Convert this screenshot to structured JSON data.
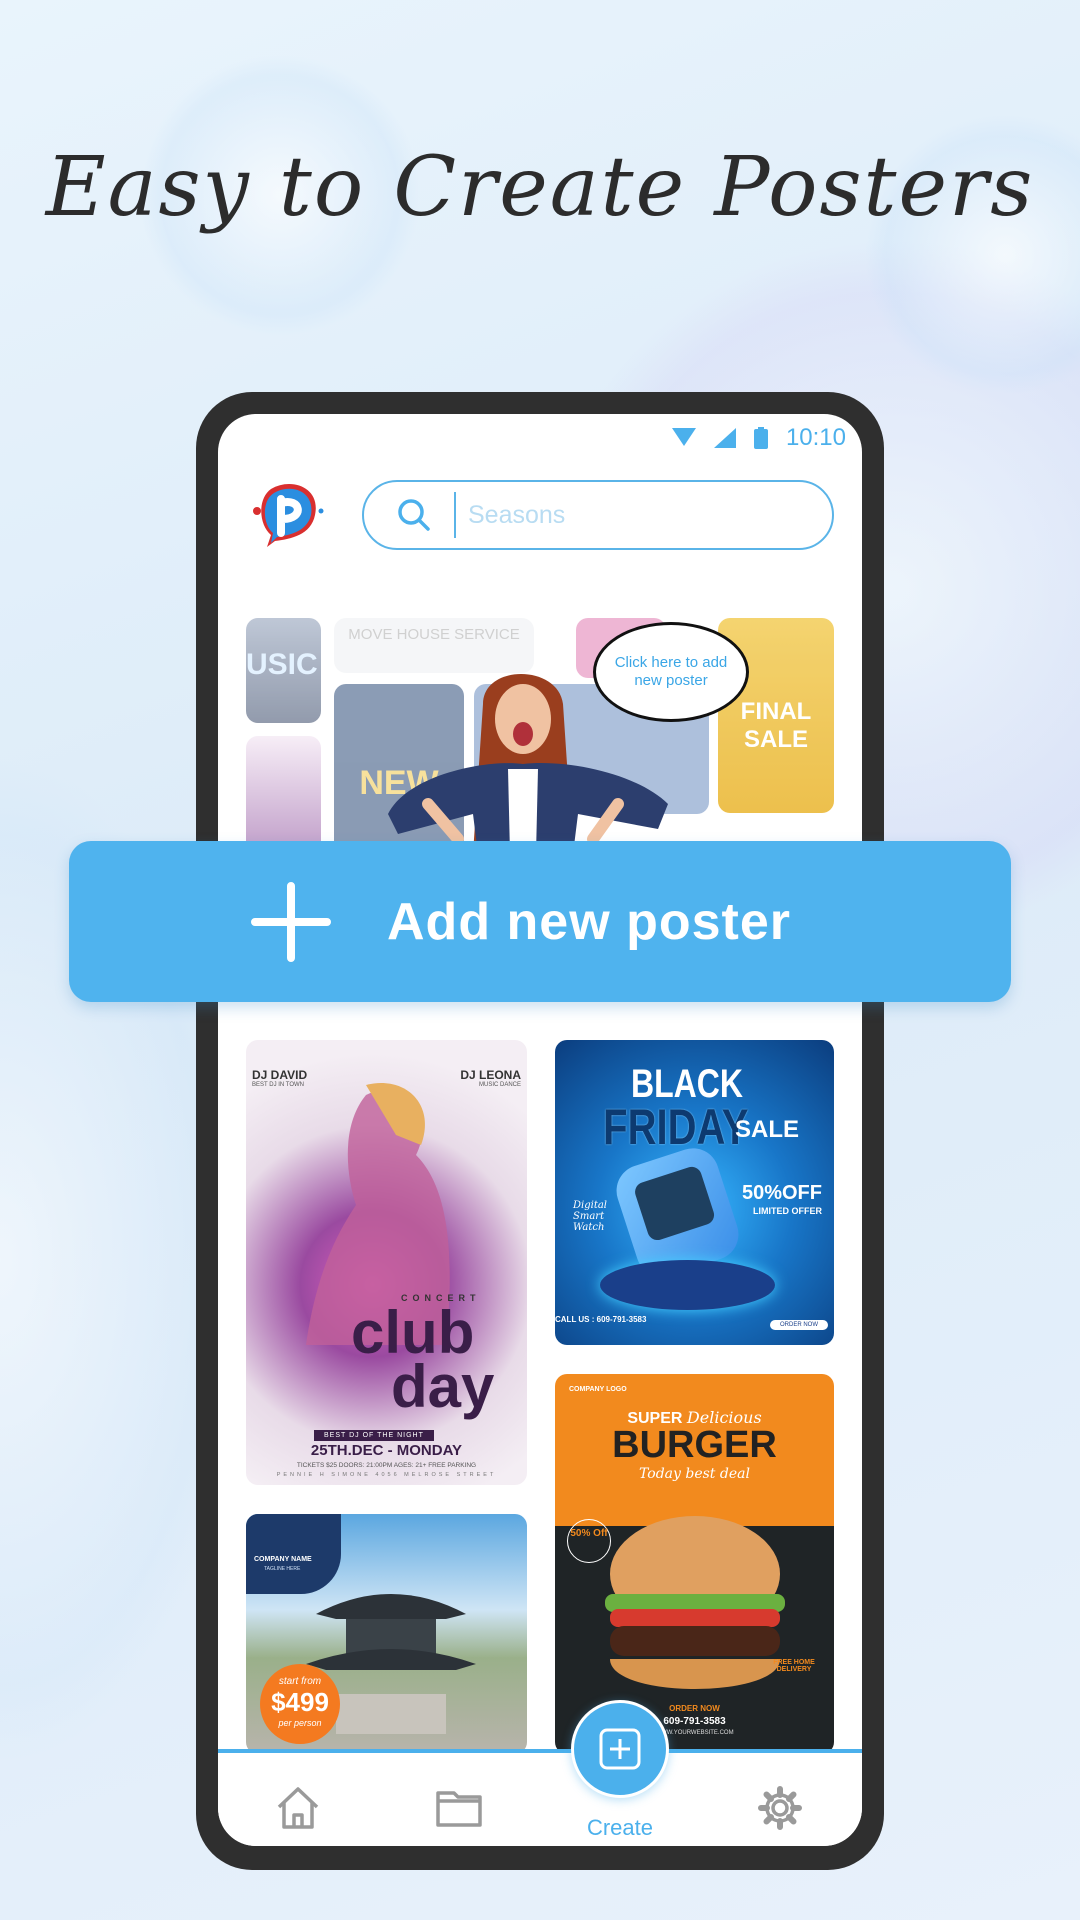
{
  "headline": "Easy to Create Posters",
  "status_bar": {
    "time": "10:10"
  },
  "search": {
    "placeholder": "Seasons"
  },
  "speech_bubble": "Click here to add new poster",
  "add_button": {
    "label": "Add new poster"
  },
  "collage_labels": [
    "MOVE HOUSE SERVICE",
    "USIC",
    "NEW",
    "FINAL SALE"
  ],
  "posters": {
    "club_day": {
      "left_dj": "DJ DAVID",
      "left_sub": "BEST DJ IN TOWN",
      "right_dj": "DJ LEONA",
      "right_sub": "MUSIC DANCE",
      "kicker": "CONCERT",
      "title1": "club",
      "title2": "day",
      "tag": "BEST DJ OF THE NIGHT",
      "date": "25TH.DEC - MONDAY",
      "info": "TICKETS $25  DOORS: 21:00PM  AGES: 21+  FREE PARKING",
      "address": "PENNIE H SIMONE 4056 MELROSE STREET"
    },
    "black_friday": {
      "line1": "BLACK",
      "line2": "FRIDAY",
      "line3": "SALE",
      "discount": "50%OFF",
      "offer": "LIMITED OFFER",
      "tagline": "Digital Smart Watch",
      "phone": "CALL US : 609-791-3583",
      "button": "ORDER NOW"
    },
    "burger": {
      "logo": "COMPANY LOGO",
      "line1": "SUPER",
      "line1b": "Delicious",
      "title": "BURGER",
      "sub": "Today best deal",
      "badge": "50% Off",
      "delivery": "FREE HOME DELIVERY",
      "order": "ORDER NOW",
      "phone": "609-791-3583",
      "web": "WWW.YOURWEBSITE.COM"
    },
    "travel": {
      "company": "COMPANY NAME",
      "tagline": "TAGLINE HERE",
      "start": "start from",
      "price": "$499",
      "per": "per person"
    }
  },
  "bottom_nav": {
    "create_label": "Create"
  },
  "colors": {
    "accent": "#4bb0ec",
    "frame": "#2f2f2f",
    "text": "#2c2c2c"
  }
}
